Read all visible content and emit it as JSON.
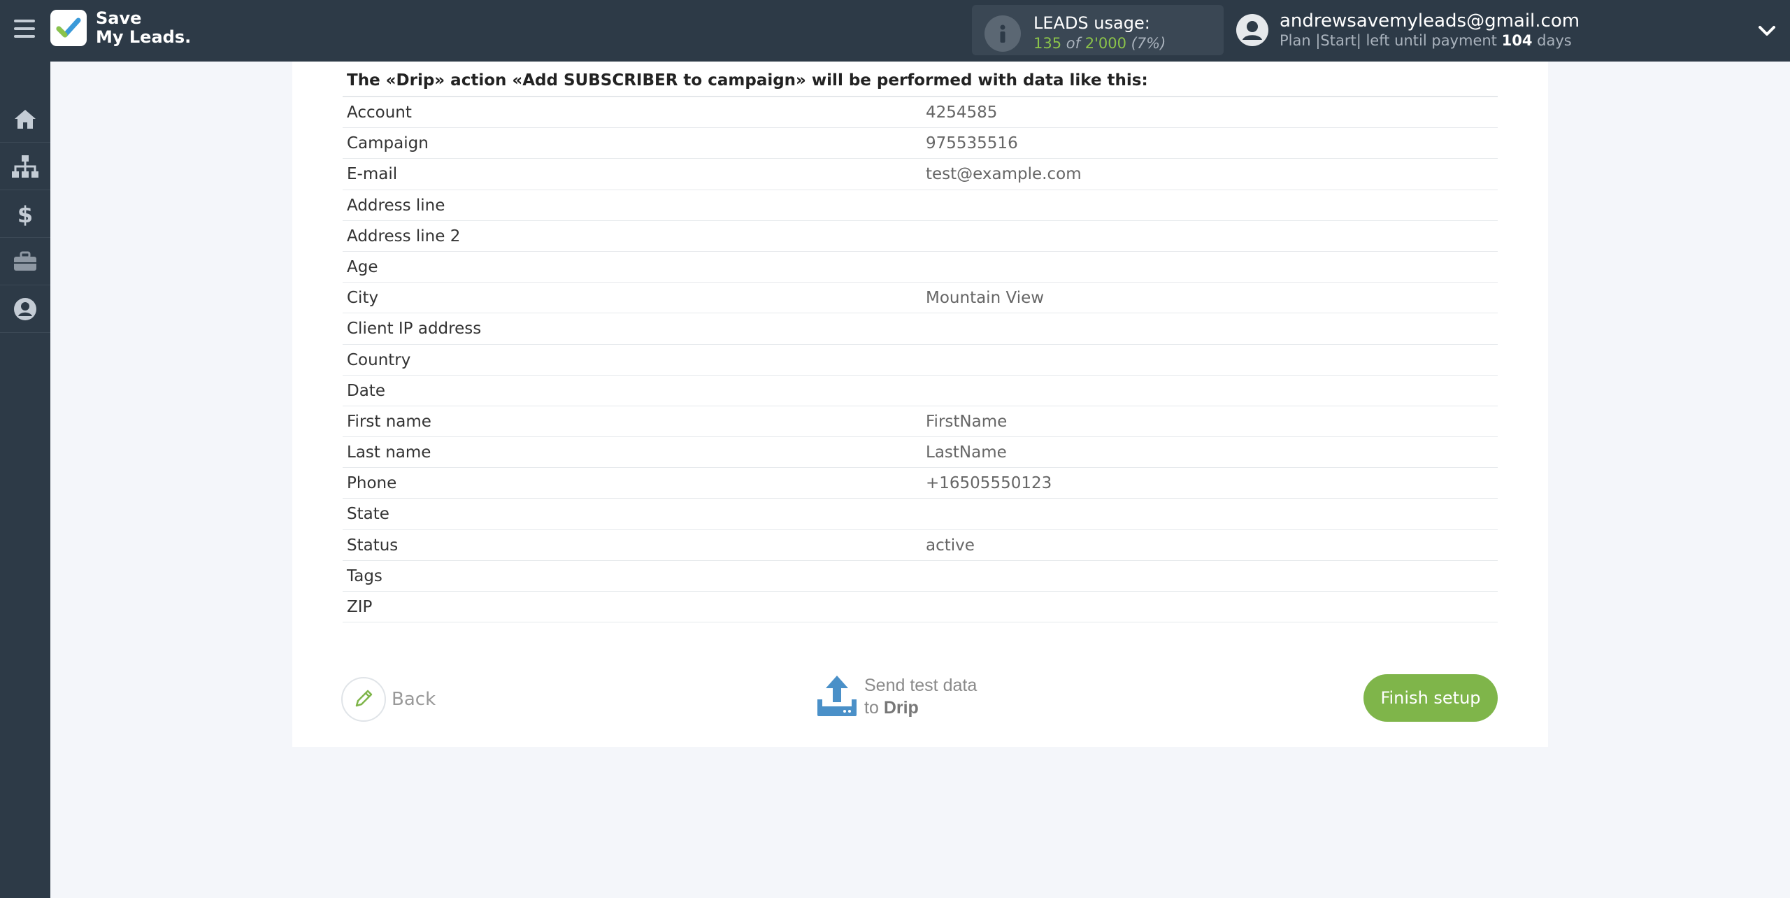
{
  "header": {
    "logo": {
      "line1": "Save",
      "line2": "My Leads."
    },
    "leads_usage": {
      "label": "LEADS usage:",
      "used": "135",
      "of_text": "of",
      "limit": "2'000",
      "percent": "(7%)"
    },
    "user": {
      "email": "andrewsavemyleads@gmail.com",
      "plan_prefix": "Plan |Start| left until payment",
      "days_count": "104",
      "days_suffix": "days"
    },
    "icons": {
      "menu": "hamburger-icon",
      "info": "info-icon",
      "user": "user-circle-icon",
      "dropdown": "chevron-down-icon"
    }
  },
  "sidebar": {
    "items": [
      {
        "name": "home",
        "icon": "home-icon"
      },
      {
        "name": "connections",
        "icon": "sitemap-icon"
      },
      {
        "name": "billing",
        "icon": "dollar-icon"
      },
      {
        "name": "tools",
        "icon": "briefcase-icon"
      },
      {
        "name": "account",
        "icon": "user-circle-icon"
      }
    ]
  },
  "main": {
    "heading": "The «Drip» action «Add SUBSCRIBER to campaign» will be performed with data like this:",
    "rows": [
      {
        "key": "Account",
        "value": "4254585"
      },
      {
        "key": "Campaign",
        "value": "975535516"
      },
      {
        "key": "E-mail",
        "value": "test@example.com"
      },
      {
        "key": "Address line",
        "value": ""
      },
      {
        "key": "Address line 2",
        "value": ""
      },
      {
        "key": "Age",
        "value": ""
      },
      {
        "key": "City",
        "value": "Mountain View"
      },
      {
        "key": "Client IP address",
        "value": ""
      },
      {
        "key": "Country",
        "value": ""
      },
      {
        "key": "Date",
        "value": ""
      },
      {
        "key": "First name",
        "value": "FirstName"
      },
      {
        "key": "Last name",
        "value": "LastName"
      },
      {
        "key": "Phone",
        "value": "+16505550123"
      },
      {
        "key": "State",
        "value": ""
      },
      {
        "key": "Status",
        "value": "active"
      },
      {
        "key": "Tags",
        "value": ""
      },
      {
        "key": "ZIP",
        "value": ""
      }
    ],
    "back_label": "Back",
    "send": {
      "line1": "Send test data",
      "line2_prefix": "to",
      "line2_target": "Drip"
    },
    "finish_label": "Finish setup"
  },
  "colors": {
    "topbar": "#2d3a47",
    "accent_green": "#7fb54a",
    "send_icon_blue": "#4a90c8"
  }
}
